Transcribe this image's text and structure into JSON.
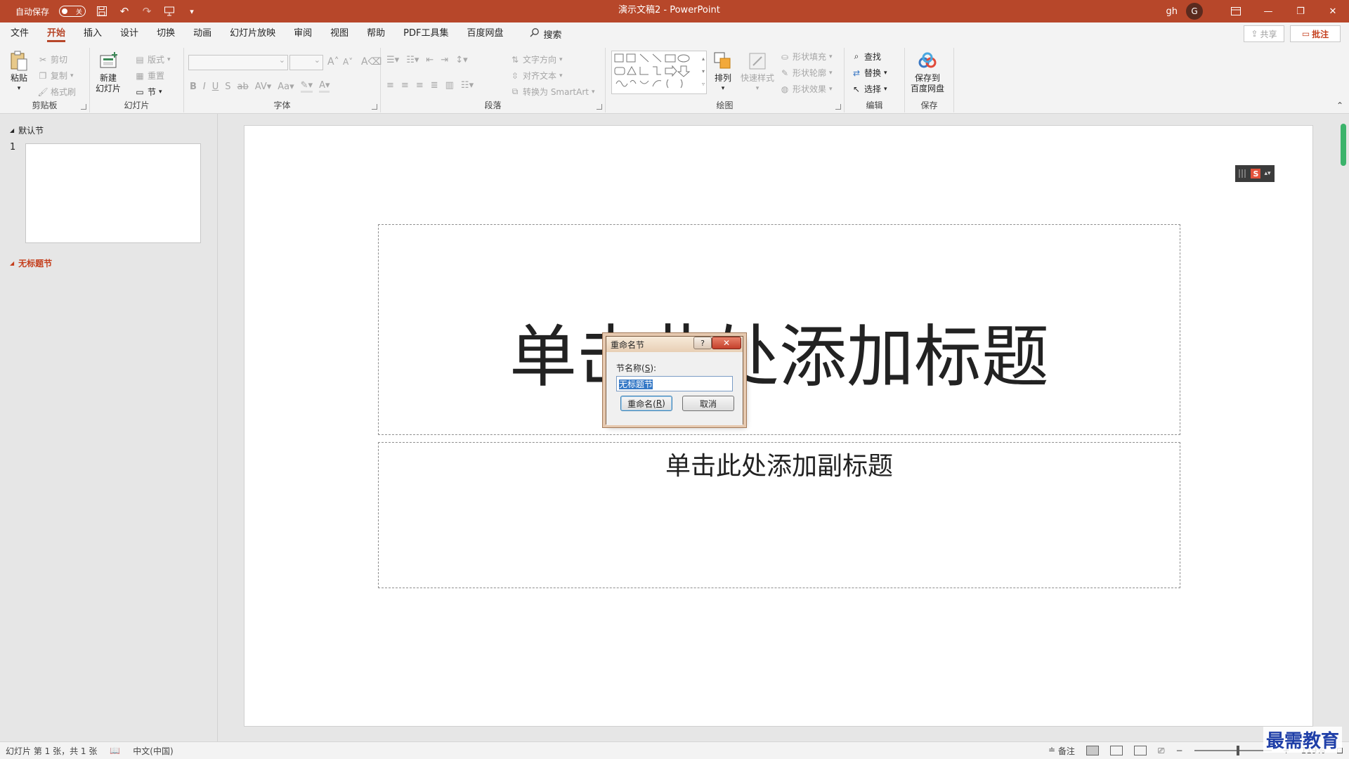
{
  "titlebar": {
    "autosave_label": "自动保存",
    "autosave_state": "关",
    "doc_title": "演示文稿2  -  PowerPoint",
    "user_name": "gh",
    "avatar_initial": "G",
    "icons": [
      "save-icon",
      "undo-icon",
      "redo-icon",
      "start-presentation-icon",
      "customize-qat-icon",
      "ribbon-display-icon",
      "minimize-icon",
      "restore-icon",
      "close-icon"
    ]
  },
  "menu": {
    "tabs": [
      {
        "label": "文件"
      },
      {
        "label": "开始"
      },
      {
        "label": "插入"
      },
      {
        "label": "设计"
      },
      {
        "label": "切换"
      },
      {
        "label": "动画"
      },
      {
        "label": "幻灯片放映"
      },
      {
        "label": "审阅"
      },
      {
        "label": "视图"
      },
      {
        "label": "帮助"
      },
      {
        "label": "PDF工具集"
      },
      {
        "label": "百度网盘"
      }
    ],
    "active_tab": "开始",
    "search_label": "搜索",
    "share_label": "共享",
    "comment_label": "批注"
  },
  "ribbon": {
    "clipboard": {
      "paste": "粘贴",
      "cut": "剪切",
      "copy": "复制",
      "format_painter": "格式刷",
      "label": "剪贴板"
    },
    "slides": {
      "new_slide_1": "新建",
      "new_slide_2": "幻灯片",
      "layout": "版式",
      "reset": "重置",
      "section": "节",
      "label": "幻灯片"
    },
    "font": {
      "label": "字体"
    },
    "paragraph": {
      "text_direction": "文字方向",
      "align_text": "对齐文本",
      "smartart": "转换为 SmartArt",
      "label": "段落"
    },
    "drawing": {
      "arrange": "排列",
      "quick_styles": "快速样式",
      "shape_fill": "形状填充",
      "shape_outline": "形状轮廓",
      "shape_effects": "形状效果",
      "label": "绘图"
    },
    "editing": {
      "find": "查找",
      "replace": "替换",
      "select": "选择",
      "label": "编辑"
    },
    "save": {
      "save_1": "保存到",
      "save_2": "百度网盘",
      "label": "保存"
    }
  },
  "left_panel": {
    "section_default": "默认节",
    "slide_number": "1",
    "section_untitled": "无标题节"
  },
  "slide": {
    "title_placeholder": "单击此处添加标题",
    "subtitle_placeholder": "单击此处添加副标题"
  },
  "dialog": {
    "title": "重命名节",
    "help": "?",
    "field_label_prefix": "节名称(",
    "field_label_key": "S",
    "field_label_suffix": "):",
    "field_value": "无标题节",
    "rename_button_prefix": "重命名(",
    "rename_button_key": "R",
    "rename_button_suffix": ")",
    "cancel_button": "取消"
  },
  "statusbar": {
    "slide_info": "幻灯片 第 1 张，共 1 张",
    "language": "中文(中国)",
    "notes": "备注",
    "zoom_minus": "−",
    "zoom_plus": "+",
    "zoom_level": "119%"
  },
  "watermark": "最需教育",
  "colors": {
    "accent": "#b7472a",
    "red_section": "#c43e1c",
    "selection": "#3478c6",
    "scroll_thumb": "#3bb36b"
  }
}
